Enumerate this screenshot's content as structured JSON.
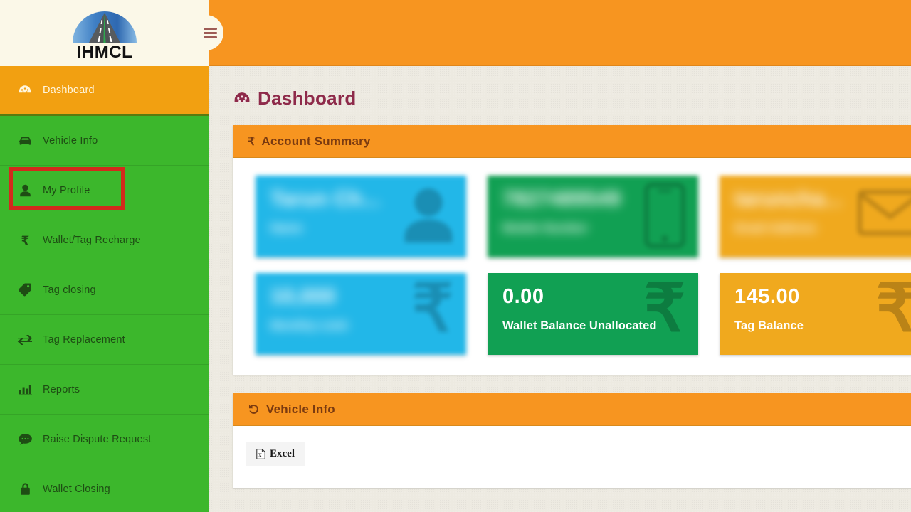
{
  "brand": {
    "logo_text": "IHMCL"
  },
  "topbar": {
    "menu_toggle_label": ""
  },
  "sidebar": {
    "items": [
      {
        "label": "Dashboard",
        "icon": "dashboard-icon",
        "active": true
      },
      {
        "label": "Vehicle Info",
        "icon": "car-icon",
        "active": false
      },
      {
        "label": "My Profile",
        "icon": "user-icon",
        "active": false
      },
      {
        "label": "Wallet/Tag Recharge",
        "icon": "rupee-icon",
        "active": false
      },
      {
        "label": "Tag closing",
        "icon": "tag-icon",
        "active": false
      },
      {
        "label": "Tag Replacement",
        "icon": "exchange-icon",
        "active": false
      },
      {
        "label": "Reports",
        "icon": "bar-chart-icon",
        "active": false
      },
      {
        "label": "Raise Dispute Request",
        "icon": "comment-icon",
        "active": false
      },
      {
        "label": "Wallet Closing",
        "icon": "lock-icon",
        "active": false
      }
    ]
  },
  "main": {
    "page_title": "Dashboard",
    "page_title_icon": "dashboard-icon",
    "account_summary": {
      "header": "Account Summary",
      "header_icon": "rupee-icon",
      "cards": [
        {
          "value": "Tarun Ch...",
          "label": "Name",
          "color": "#22B7E8",
          "watermark": "user-icon",
          "redacted": true
        },
        {
          "value": "7827489549",
          "label": "Mobile Number",
          "color": "#11A053",
          "watermark": "phone-icon",
          "redacted": true
        },
        {
          "value": "taruncha...",
          "label": "Email Address",
          "color": "#F0A91E",
          "watermark": "mail-icon",
          "redacted": true
        },
        {
          "value": "10,000",
          "label": "Monthly Limit",
          "color": "#22B7E8",
          "watermark": "rupee-icon",
          "redacted": true
        },
        {
          "value": "0.00",
          "label": "Wallet Balance Unallocated",
          "color": "#11A053",
          "watermark": "rupee-icon",
          "redacted": false
        },
        {
          "value": "145.00",
          "label": "Tag Balance",
          "color": "#F0A91E",
          "watermark": "rupee-icon",
          "redacted": false
        }
      ]
    },
    "vehicle_info": {
      "header": "Vehicle Info",
      "header_icon": "history-icon",
      "export_button": "Excel",
      "export_button_icon": "excel-file-icon"
    }
  },
  "annotation": {
    "highlight_target": "My Profile",
    "highlight_color": "#D32A1C"
  },
  "colors": {
    "topbar_orange": "#F79520",
    "sidebar_green": "#3CB72C",
    "sidebar_active_orange": "#F2A011",
    "panel_header_orange": "#F79520",
    "page_title_maroon": "#8E2A4A",
    "content_bg": "#EDEAE1",
    "logo_bg": "#FBF8E8"
  }
}
